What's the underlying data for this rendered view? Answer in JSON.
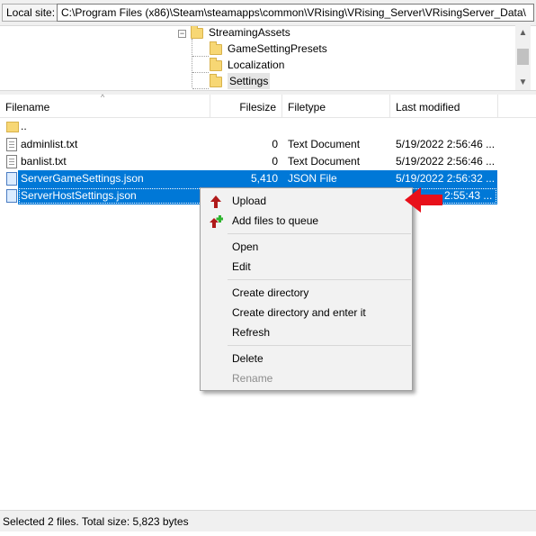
{
  "local_site": {
    "label": "Local site:",
    "path": "C:\\Program Files (x86)\\Steam\\steamapps\\common\\VRising\\VRising_Server\\VRisingServer_Data\\"
  },
  "tree": {
    "items": [
      {
        "label": "StreamingAssets",
        "icon": "folder-icon"
      },
      {
        "label": "GameSettingPresets",
        "icon": "folder-icon"
      },
      {
        "label": "Localization",
        "icon": "folder-icon"
      },
      {
        "label": "Settings",
        "icon": "folder-icon"
      }
    ],
    "expander": "−"
  },
  "file_list": {
    "columns": [
      "Filename",
      "Filesize",
      "Filetype",
      "Last modified"
    ],
    "sort_indicator": "^",
    "rows": [
      {
        "name": "..",
        "size": "",
        "type": "",
        "modified": "",
        "icon": "parent-folder-icon",
        "selected": false
      },
      {
        "name": "adminlist.txt",
        "size": "0",
        "type": "Text Document",
        "modified": "5/19/2022 2:56:46 ...",
        "icon": "text-file-icon",
        "selected": false
      },
      {
        "name": "banlist.txt",
        "size": "0",
        "type": "Text Document",
        "modified": "5/19/2022 2:56:46 ...",
        "icon": "text-file-icon",
        "selected": false
      },
      {
        "name": "ServerGameSettings.json",
        "size": "5,410",
        "type": "JSON File",
        "modified": "5/19/2022 2:56:32 ...",
        "icon": "json-file-icon",
        "selected": true
      },
      {
        "name": "ServerHostSettings.json",
        "size": "",
        "type": "",
        "modified": "2:55:43 ...",
        "icon": "json-file-icon",
        "selected": true
      }
    ]
  },
  "context_menu": {
    "items": [
      {
        "label": "Upload",
        "icon": "upload-arrow-icon",
        "enabled": true
      },
      {
        "label": "Add files to queue",
        "icon": "add-to-queue-icon",
        "enabled": true
      },
      {
        "label": "Open",
        "enabled": true
      },
      {
        "label": "Edit",
        "enabled": true
      },
      {
        "label": "Create directory",
        "enabled": true
      },
      {
        "label": "Create directory and enter it",
        "enabled": true
      },
      {
        "label": "Refresh",
        "enabled": true
      },
      {
        "label": "Delete",
        "enabled": true
      },
      {
        "label": "Rename",
        "enabled": false
      }
    ]
  },
  "annotation": {
    "icon": "red-arrow-icon",
    "color": "#e8101a"
  },
  "status_bar": {
    "text": "Selected 2 files. Total size: 5,823 bytes"
  },
  "colors": {
    "selection": "#0078d7",
    "folder": "#f7d774",
    "upload_icon": "#b01a1a",
    "queue_icon_plus": "#2fb52f"
  }
}
